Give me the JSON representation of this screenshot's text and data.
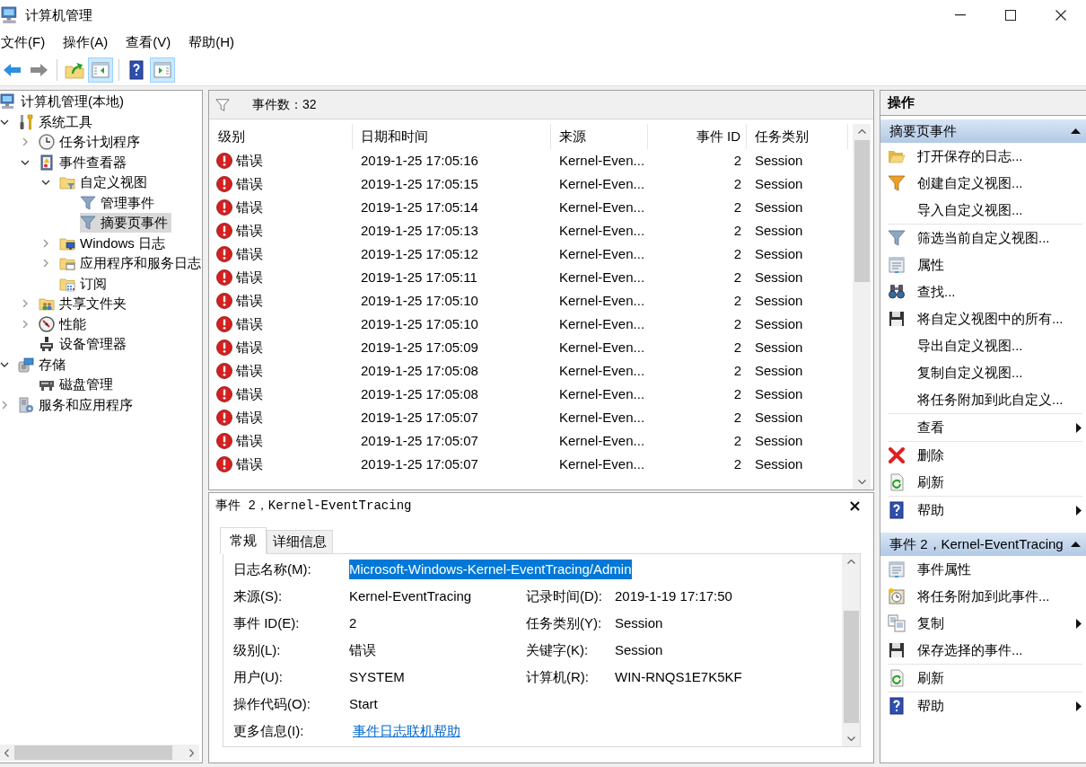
{
  "window": {
    "title": "计算机管理"
  },
  "menu": [
    "文件(F)",
    "操作(A)",
    "查看(V)",
    "帮助(H)"
  ],
  "toolbar": [
    {
      "on": false,
      "disabled": false
    },
    {
      "on": false,
      "disabled": true
    },
    {
      "on": false,
      "disabled": false
    },
    {
      "on": true,
      "disabled": false
    },
    {
      "on": false,
      "disabled": false
    },
    {
      "on": true,
      "disabled": false
    }
  ],
  "tree": {
    "root": {
      "label": "计算机管理(本地)",
      "selected": false,
      "children": [
        {
          "label": "系统工具",
          "expandable": true,
          "expanded": true,
          "selected": false,
          "children": [
            {
              "label": "任务计划程序",
              "expandable": true,
              "expanded": false,
              "selected": false
            },
            {
              "label": "事件查看器",
              "expandable": true,
              "expanded": true,
              "selected": false,
              "children": [
                {
                  "label": "自定义视图",
                  "expandable": true,
                  "expanded": true,
                  "selected": false,
                  "children": [
                    {
                      "label": "管理事件",
                      "expandable": false,
                      "selected": false
                    },
                    {
                      "label": "摘要页事件",
                      "expandable": false,
                      "selected": true
                    }
                  ]
                },
                {
                  "label": "Windows 日志",
                  "expandable": true,
                  "expanded": false,
                  "selected": false
                },
                {
                  "label": "应用程序和服务日志",
                  "expandable": true,
                  "expanded": false,
                  "selected": false
                },
                {
                  "label": "订阅",
                  "expandable": false,
                  "selected": false
                }
              ]
            },
            {
              "label": "共享文件夹",
              "expandable": true,
              "expanded": false,
              "selected": false
            },
            {
              "label": "性能",
              "expandable": true,
              "expanded": false,
              "selected": false
            },
            {
              "label": "设备管理器",
              "expandable": false,
              "selected": false
            }
          ]
        },
        {
          "label": "存储",
          "expandable": true,
          "expanded": true,
          "selected": false,
          "children": [
            {
              "label": "磁盘管理",
              "expandable": false,
              "selected": false
            }
          ]
        },
        {
          "label": "服务和应用程序",
          "expandable": true,
          "expanded": false,
          "selected": false
        }
      ]
    }
  },
  "events": {
    "title": "事件数：32",
    "columns": [
      "级别",
      "日期和时间",
      "来源",
      "事件 ID",
      "任务类别"
    ],
    "rows": [
      {
        "level": "错误",
        "date_time": "2019-1-25 17:05:16",
        "source": "Kernel-Even...",
        "event_id": "2",
        "task_category": "Session"
      },
      {
        "level": "错误",
        "date_time": "2019-1-25 17:05:15",
        "source": "Kernel-Even...",
        "event_id": "2",
        "task_category": "Session"
      },
      {
        "level": "错误",
        "date_time": "2019-1-25 17:05:14",
        "source": "Kernel-Even...",
        "event_id": "2",
        "task_category": "Session"
      },
      {
        "level": "错误",
        "date_time": "2019-1-25 17:05:13",
        "source": "Kernel-Even...",
        "event_id": "2",
        "task_category": "Session"
      },
      {
        "level": "错误",
        "date_time": "2019-1-25 17:05:12",
        "source": "Kernel-Even...",
        "event_id": "2",
        "task_category": "Session"
      },
      {
        "level": "错误",
        "date_time": "2019-1-25 17:05:11",
        "source": "Kernel-Even...",
        "event_id": "2",
        "task_category": "Session"
      },
      {
        "level": "错误",
        "date_time": "2019-1-25 17:05:10",
        "source": "Kernel-Even...",
        "event_id": "2",
        "task_category": "Session"
      },
      {
        "level": "错误",
        "date_time": "2019-1-25 17:05:10",
        "source": "Kernel-Even...",
        "event_id": "2",
        "task_category": "Session"
      },
      {
        "level": "错误",
        "date_time": "2019-1-25 17:05:09",
        "source": "Kernel-Even...",
        "event_id": "2",
        "task_category": "Session"
      },
      {
        "level": "错误",
        "date_time": "2019-1-25 17:05:08",
        "source": "Kernel-Even...",
        "event_id": "2",
        "task_category": "Session"
      },
      {
        "level": "错误",
        "date_time": "2019-1-25 17:05:08",
        "source": "Kernel-Even...",
        "event_id": "2",
        "task_category": "Session"
      },
      {
        "level": "错误",
        "date_time": "2019-1-25 17:05:07",
        "source": "Kernel-Even...",
        "event_id": "2",
        "task_category": "Session"
      },
      {
        "level": "错误",
        "date_time": "2019-1-25 17:05:07",
        "source": "Kernel-Even...",
        "event_id": "2",
        "task_category": "Session"
      },
      {
        "level": "错误",
        "date_time": "2019-1-25 17:05:07",
        "source": "Kernel-Even...",
        "event_id": "2",
        "task_category": "Session"
      }
    ]
  },
  "detail": {
    "title": "事件 2，Kernel-EventTracing",
    "tabs": [
      {
        "label": "常规",
        "selected": true
      },
      {
        "label": "详细信息",
        "selected": false
      }
    ],
    "fields": [
      {
        "cells": [
          {
            "label": "日志名称(M):",
            "value": "Microsoft-Windows-Kernel-EventTracing/Admin",
            "kind": "highlighted"
          }
        ]
      },
      {
        "cells": [
          {
            "label": "来源(S):",
            "value": "Kernel-EventTracing",
            "kind": "text"
          },
          {
            "label": "记录时间(D):",
            "value": "2019-1-19 17:17:50",
            "kind": "text"
          }
        ]
      },
      {
        "cells": [
          {
            "label": "事件 ID(E):",
            "value": "2",
            "kind": "text"
          },
          {
            "label": "任务类别(Y):",
            "value": "Session",
            "kind": "text"
          }
        ]
      },
      {
        "cells": [
          {
            "label": "级别(L):",
            "value": "错误",
            "kind": "text"
          },
          {
            "label": "关键字(K):",
            "value": "Session",
            "kind": "text"
          }
        ]
      },
      {
        "cells": [
          {
            "label": "用户(U):",
            "value": "SYSTEM",
            "kind": "text"
          },
          {
            "label": "计算机(R):",
            "value": "WIN-RNQS1E7K5KF",
            "kind": "text"
          }
        ]
      },
      {
        "cells": [
          {
            "label": "操作代码(O):",
            "value": "Start",
            "kind": "text"
          }
        ]
      },
      {
        "cells": [
          {
            "label": "更多信息(I):",
            "value": "事件日志联机帮助",
            "kind": "link"
          }
        ]
      }
    ]
  },
  "actions": {
    "title": "操作",
    "sections": [
      {
        "title": "摘要页事件",
        "expanded": true,
        "groups": [
          {
            "items": [
              {
                "label": "打开保存的日志...",
                "submenu": false
              },
              {
                "label": "创建自定义视图...",
                "submenu": false
              },
              {
                "label": "导入自定义视图...",
                "submenu": false
              }
            ]
          },
          {
            "items": [
              {
                "label": "筛选当前自定义视图...",
                "submenu": false
              },
              {
                "label": "属性",
                "submenu": false
              },
              {
                "label": "查找...",
                "submenu": false
              },
              {
                "label": "将自定义视图中的所有...",
                "submenu": false
              },
              {
                "label": "导出自定义视图...",
                "submenu": false
              },
              {
                "label": "复制自定义视图...",
                "submenu": false
              },
              {
                "label": "将任务附加到此自定义...",
                "submenu": false
              }
            ]
          },
          {
            "items": [
              {
                "label": "查看",
                "submenu": true
              }
            ]
          },
          {
            "items": [
              {
                "label": "删除",
                "submenu": false
              },
              {
                "label": "刷新",
                "submenu": false
              }
            ]
          },
          {
            "items": [
              {
                "label": "帮助",
                "submenu": true
              }
            ]
          }
        ]
      },
      {
        "title": "事件 2，Kernel-EventTracing",
        "expanded": true,
        "groups": [
          {
            "items": [
              {
                "label": "事件属性",
                "submenu": false
              },
              {
                "label": "将任务附加到此事件...",
                "submenu": false
              },
              {
                "label": "复制",
                "submenu": true
              },
              {
                "label": "保存选择的事件...",
                "submenu": false
              }
            ]
          },
          {
            "items": [
              {
                "label": "刷新",
                "submenu": false
              }
            ]
          },
          {
            "items": [
              {
                "label": "帮助",
                "submenu": true
              }
            ]
          }
        ]
      }
    ]
  }
}
